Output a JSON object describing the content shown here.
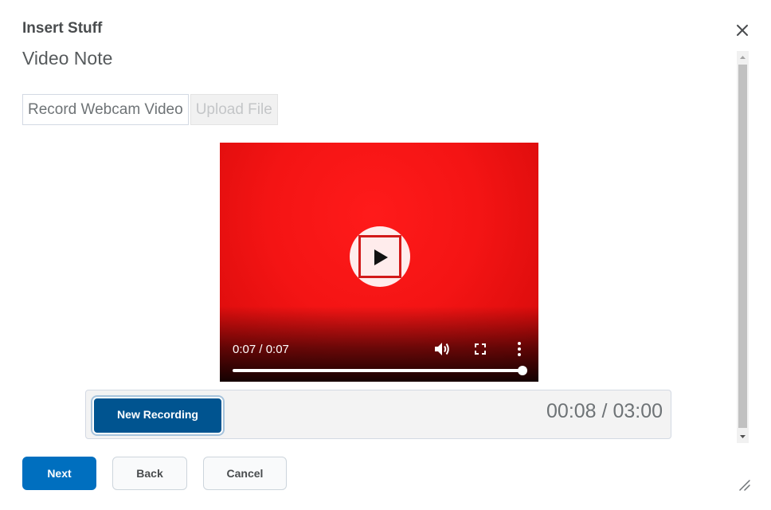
{
  "dialog": {
    "title": "Insert Stuff"
  },
  "page": {
    "title": "Video Note"
  },
  "tabs": [
    {
      "label": "Record Webcam Video",
      "state": "active"
    },
    {
      "label": "Upload File",
      "state": "disabled"
    }
  ],
  "video": {
    "time": "0:07 / 0:07",
    "progress_fraction": 1.0,
    "play_icon": "play-icon",
    "volume_icon": "volume-icon",
    "fullscreen_icon": "fullscreen-icon",
    "more_icon": "more-vertical-icon"
  },
  "recorder": {
    "new_recording_label": "New Recording",
    "elapsed": "00:08",
    "separator": "/",
    "limit": "03:00"
  },
  "footer": {
    "next_label": "Next",
    "back_label": "Back",
    "cancel_label": "Cancel"
  },
  "colors": {
    "primary": "#006fbf",
    "new_recording": "#005490",
    "video_background": "#f41414"
  }
}
